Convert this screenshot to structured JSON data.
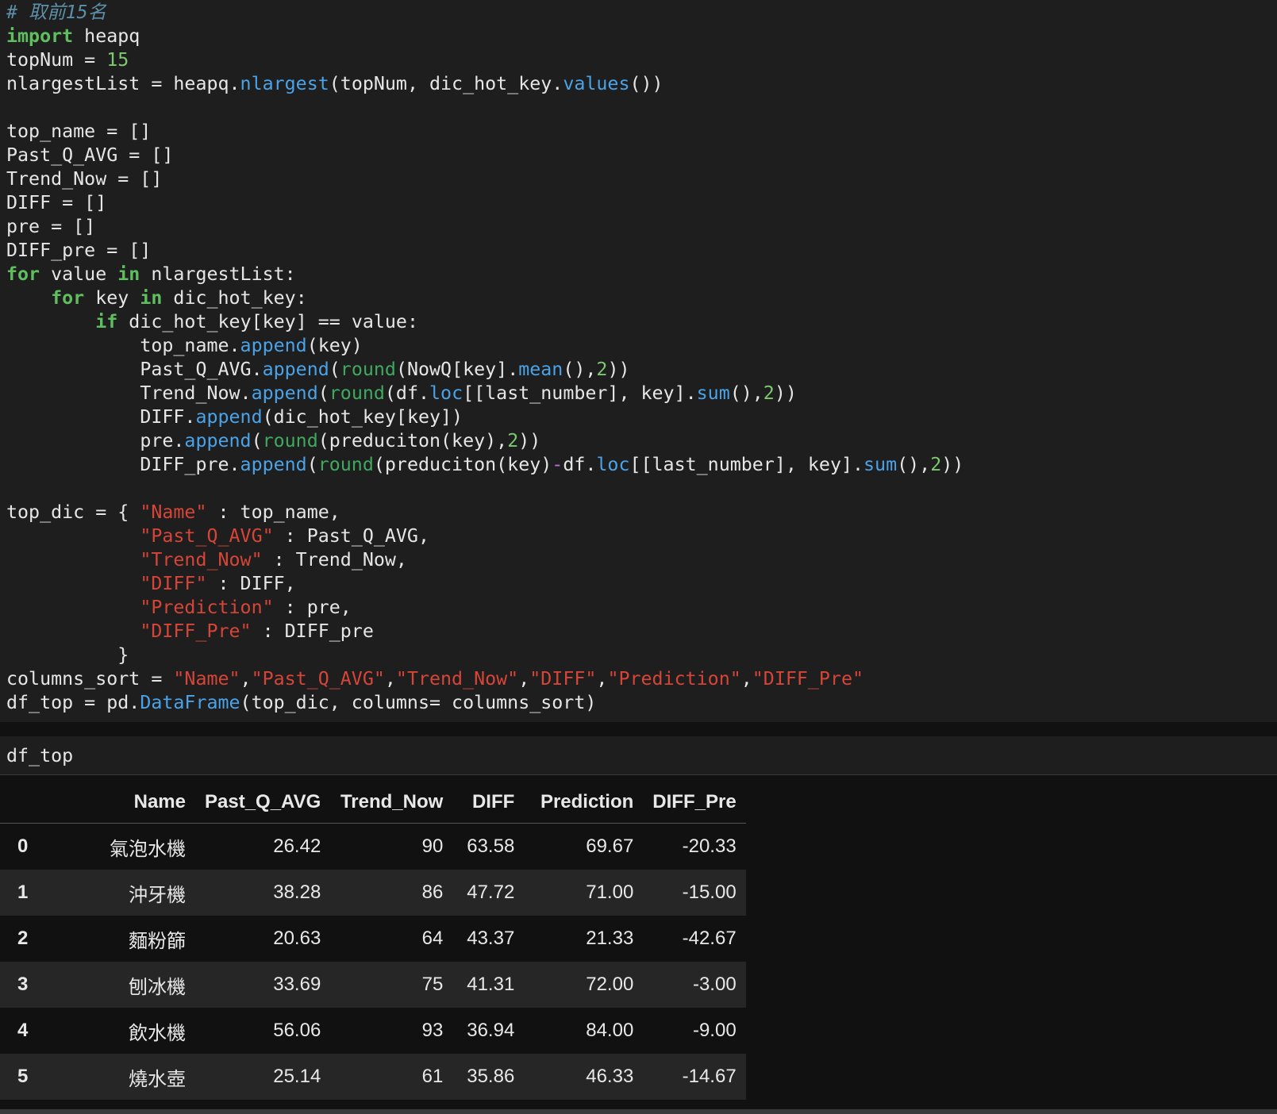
{
  "code_cell": {
    "comment": "# 取前15名",
    "kw_import": "import",
    "kw_for": "for",
    "kw_in": "in",
    "kw_if": "if",
    "fn_nlargest": "nlargest",
    "fn_values": "values",
    "fn_append": "append",
    "fn_round": "round",
    "fn_mean": "mean",
    "fn_loc": "loc",
    "fn_sum": "sum",
    "fn_DataFrame": "DataFrame",
    "num_15": "15",
    "num_2": "2",
    "op_minus": "-",
    "str_name": "\"Name\"",
    "str_past": "\"Past_Q_AVG\"",
    "str_trend": "\"Trend_Now\"",
    "str_diff": "\"DIFF\"",
    "str_pred": "\"Prediction\"",
    "str_diffpre": "\"DIFF_Pre\"",
    "t_import_rest": " heapq",
    "t_topnum": "topNum = ",
    "t_nl_1": "nlargestList = heapq.",
    "t_nl_2": "(topNum, dic_hot_key.",
    "t_nl_3": "())",
    "t_init_1": "top_name = []",
    "t_init_2": "Past_Q_AVG = []",
    "t_init_3": "Trend_Now = []",
    "t_init_4": "DIFF = []",
    "t_init_5": "pre = []",
    "t_init_6": "DIFF_pre = []",
    "t_for1_1": " value ",
    "t_for1_2": " nlargestList:",
    "t_for2_1": " key ",
    "t_for2_2": " dic_hot_key:",
    "t_if_1": " dic_hot_key[key] == value:",
    "t_a1_1": "top_name.",
    "t_a1_2": "(key)",
    "t_a2_1": "Past_Q_AVG.",
    "t_a2_2": "(NowQ[key].",
    "t_open": "(",
    "t_close2": "))",
    "t_comma_close": "(),",
    "t_a3_1": "Trend_Now.",
    "t_a3_2": "(df.",
    "t_a3_3": "[[last_number], key].",
    "t_a4_1": "DIFF.",
    "t_a4_2": "(dic_hot_key[key])",
    "t_a5_1": "pre.",
    "t_a5_2": "(preduciton(key),",
    "t_a6_1": "DIFF_pre.",
    "t_a6_2": "(preduciton(key)",
    "t_a6_3": "df.",
    "t_dic_open": "top_dic = { ",
    "t_dic_1": " : top_name,",
    "t_dic_2": " : Past_Q_AVG,",
    "t_dic_3": " : Trend_Now,",
    "t_dic_4": " : DIFF,",
    "t_dic_5": " : pre,",
    "t_dic_6": " : DIFF_pre",
    "t_dic_close": "}",
    "t_cols_1": "columns_sort = ",
    "t_comma": ",",
    "t_df_1": "df_top = pd.",
    "t_df_2": "(top_dic, columns= columns_sort)"
  },
  "input_cell": {
    "code": "df_top"
  },
  "dataframe": {
    "columns": [
      "Name",
      "Past_Q_AVG",
      "Trend_Now",
      "DIFF",
      "Prediction",
      "DIFF_Pre"
    ],
    "rows": [
      {
        "index": "0",
        "cells": [
          "氣泡水機",
          "26.42",
          "90",
          "63.58",
          "69.67",
          "-20.33"
        ]
      },
      {
        "index": "1",
        "cells": [
          "沖牙機",
          "38.28",
          "86",
          "47.72",
          "71.00",
          "-15.00"
        ]
      },
      {
        "index": "2",
        "cells": [
          "麵粉篩",
          "20.63",
          "64",
          "43.37",
          "21.33",
          "-42.67"
        ]
      },
      {
        "index": "3",
        "cells": [
          "刨冰機",
          "33.69",
          "75",
          "41.31",
          "72.00",
          "-3.00"
        ]
      },
      {
        "index": "4",
        "cells": [
          "飲水機",
          "56.06",
          "93",
          "36.94",
          "84.00",
          "-9.00"
        ]
      },
      {
        "index": "5",
        "cells": [
          "燒水壺",
          "25.14",
          "61",
          "35.86",
          "46.33",
          "-14.67"
        ]
      }
    ]
  },
  "colors": {
    "background": "#111111",
    "cell_background": "#1e1e1e",
    "keyword": "#5fbf5f",
    "function": "#4aa3e8",
    "string": "#d64537",
    "number": "#7dc96f",
    "comment": "#5d8fa8"
  }
}
